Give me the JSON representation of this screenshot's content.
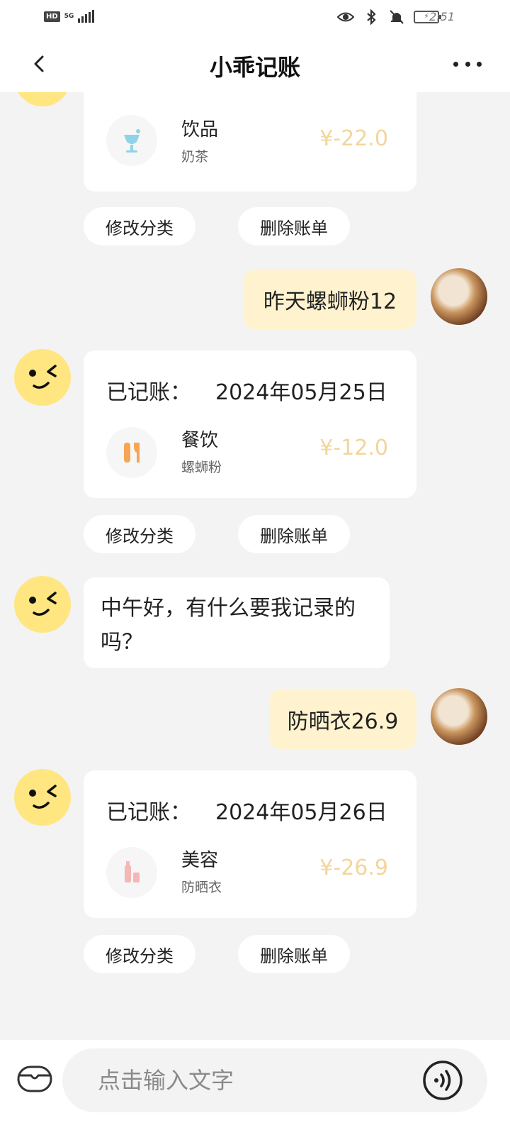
{
  "status_bar": {
    "hd": "HD",
    "network": "5G",
    "time": "2:51",
    "battery": "⚡"
  },
  "header": {
    "title": "小乖记账"
  },
  "messages": {
    "card1": {
      "category": "饮品",
      "note": "奶茶",
      "amount": "¥-22.0"
    },
    "actions1": {
      "modify": "修改分类",
      "delete": "删除账单"
    },
    "user1": {
      "text": "昨天螺蛳粉12"
    },
    "card2": {
      "title": "已记账：",
      "date": "2024年05月25日",
      "category": "餐饮",
      "note": "螺蛳粉",
      "amount": "¥-12.0"
    },
    "actions2": {
      "modify": "修改分类",
      "delete": "删除账单"
    },
    "bot1": {
      "text": "中午好，有什么要我记录的吗？"
    },
    "user2": {
      "text": "防晒衣26.9"
    },
    "card3": {
      "title": "已记账：",
      "date": "2024年05月26日",
      "category": "美容",
      "note": "防晒衣",
      "amount": "¥-26.9"
    },
    "actions3": {
      "modify": "修改分类",
      "delete": "删除账单"
    }
  },
  "input": {
    "placeholder": "点击输入文字"
  },
  "colors": {
    "accent": "#ffe680",
    "amount": "#f3d59a",
    "user_bubble": "#fff3cf",
    "background": "#f3f3f3"
  }
}
